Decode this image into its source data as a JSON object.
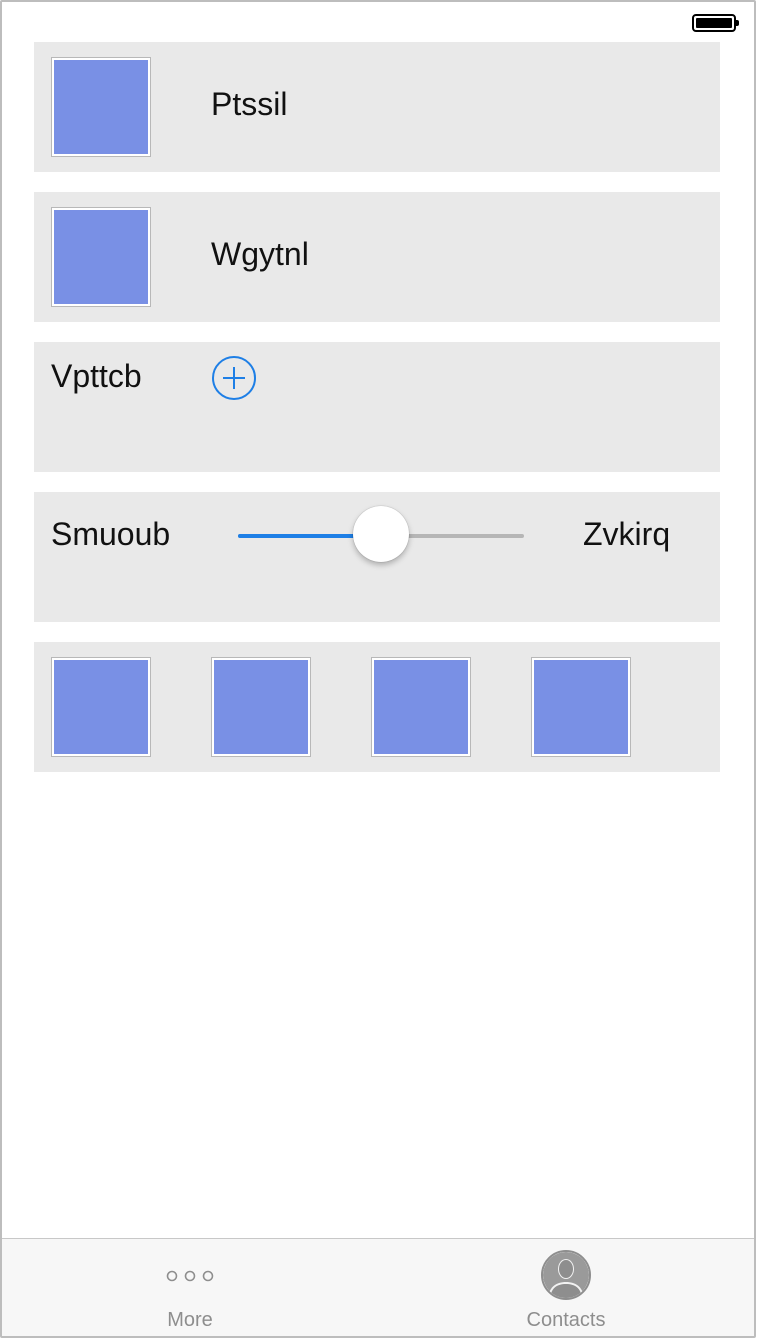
{
  "status_bar": {
    "battery_level": 1.0
  },
  "rows": [
    {
      "label": "Ptssil"
    },
    {
      "label": "Wgytnl"
    },
    {
      "label": "Vpttcb"
    }
  ],
  "slider_row": {
    "min_label": "Smuoub",
    "max_label": "Zvkirq",
    "value": 0.5,
    "accent_color": "#1e7fe6"
  },
  "image_strip": {
    "count": 4
  },
  "colors": {
    "image_placeholder": "#7990e5",
    "card_background": "#e9e9e9",
    "accent": "#1e7fe6"
  },
  "tabbar": {
    "tabs": [
      {
        "label": "More",
        "icon": "more-dots-icon"
      },
      {
        "label": "Contacts",
        "icon": "contact-avatar-icon"
      }
    ]
  }
}
